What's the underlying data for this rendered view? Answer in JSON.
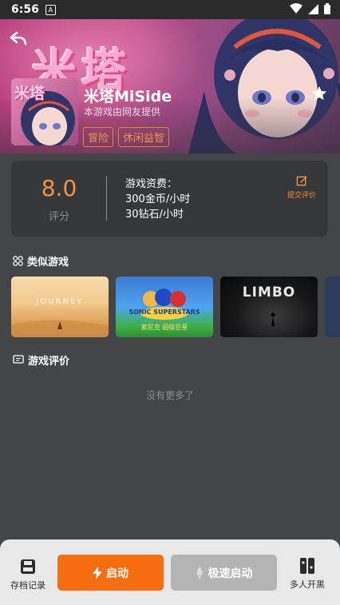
{
  "status_bar": {
    "time": "6:56",
    "notif_badge": "A"
  },
  "hero": {
    "art_title": "米塔",
    "cover_title": "米塔",
    "game_name": "米塔MiSide",
    "provided_by": "本游戏由网友提供",
    "tags": [
      "冒险",
      "休闲益智"
    ]
  },
  "rating": {
    "score": "8.0",
    "score_label": "评分",
    "fee_title": "游戏资费：",
    "fee_lines": [
      "300金币/小时",
      "30钻石/小时"
    ],
    "submit_label": "提交评价"
  },
  "similar": {
    "title": "类似游戏",
    "games": [
      {
        "name": "JOURNEY"
      },
      {
        "name": "SONIC SUPERSTARS",
        "subtitle": "索尼克 超级巨星"
      },
      {
        "name": "LIMBO"
      }
    ]
  },
  "reviews": {
    "title": "游戏评价",
    "empty_text": "没有更多了"
  },
  "bottom_bar": {
    "save_label": "存档记录",
    "launch_label": "启动",
    "fast_launch_label": "极速启动",
    "multi_label": "多人开黑"
  },
  "colors": {
    "accent": "#f66d12",
    "tag": "#f39240",
    "bg": "#444546",
    "card": "#363738"
  }
}
